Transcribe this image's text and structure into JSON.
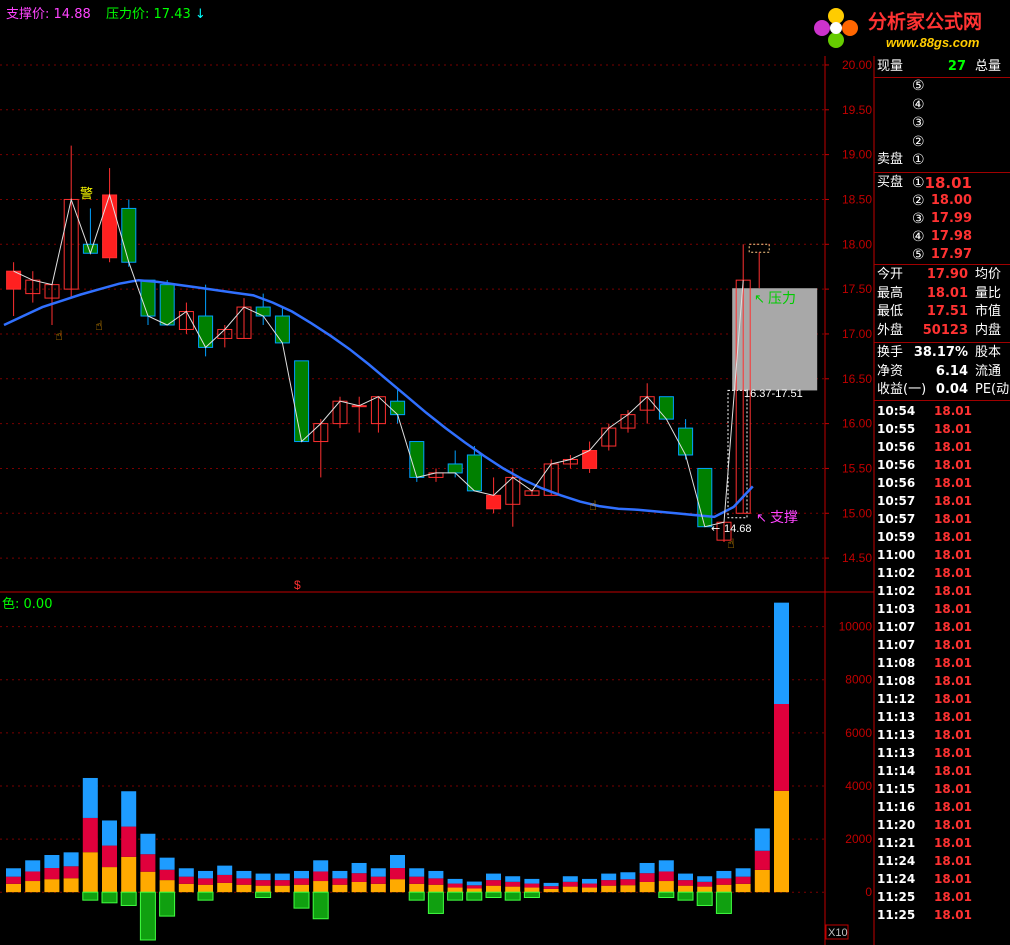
{
  "header": {
    "support_label": "支撑价:",
    "support_value": "14.88",
    "pressure_label": "压力价:",
    "pressure_value": "17.43",
    "pressure_arrow": "↓"
  },
  "volume_header": {
    "label": "色:",
    "value": "0.00"
  },
  "logo": {
    "text": "分析家公式网",
    "url": "www.88gs.com"
  },
  "annotations": {
    "warning": "警",
    "pressure": "压力",
    "support": "支撑",
    "range": "16.37-17.51",
    "low_marker": "14.68",
    "dollar": "$",
    "x10": "X10"
  },
  "quote_panel": {
    "top": {
      "label": "现量",
      "value": "27",
      "label2": "总量"
    },
    "sell_label": "卖盘",
    "buy_label": "买盘",
    "sell_levels": [
      "⑤",
      "④",
      "③",
      "②",
      "①"
    ],
    "buy_levels": [
      {
        "level": "①",
        "price": "18.01"
      },
      {
        "level": "②",
        "price": "18.00"
      },
      {
        "level": "③",
        "price": "17.99"
      },
      {
        "level": "④",
        "price": "17.98"
      },
      {
        "level": "⑤",
        "price": "17.97"
      }
    ],
    "stats": [
      {
        "label": "今开",
        "value": "17.90",
        "label2": "均价"
      },
      {
        "label": "最高",
        "value": "18.01",
        "label2": "量比"
      },
      {
        "label": "最低",
        "value": "17.51",
        "label2": "市值"
      },
      {
        "label": "外盘",
        "value": "50123",
        "label2": "内盘"
      }
    ],
    "stats2": [
      {
        "label": "换手",
        "value": "38.17%",
        "label2": "股本"
      },
      {
        "label": "净资",
        "value": "6.14",
        "label2": "流通"
      },
      {
        "label": "收益(一)",
        "value": "0.04",
        "label2": "PE(动"
      }
    ]
  },
  "ticks": [
    {
      "time": "10:54",
      "price": "18.01"
    },
    {
      "time": "10:55",
      "price": "18.01"
    },
    {
      "time": "10:56",
      "price": "18.01"
    },
    {
      "time": "10:56",
      "price": "18.01"
    },
    {
      "time": "10:56",
      "price": "18.01"
    },
    {
      "time": "10:57",
      "price": "18.01"
    },
    {
      "time": "10:57",
      "price": "18.01"
    },
    {
      "time": "10:59",
      "price": "18.01"
    },
    {
      "time": "11:00",
      "price": "18.01"
    },
    {
      "time": "11:02",
      "price": "18.01"
    },
    {
      "time": "11:02",
      "price": "18.01"
    },
    {
      "time": "11:03",
      "price": "18.01"
    },
    {
      "time": "11:07",
      "price": "18.01"
    },
    {
      "time": "11:07",
      "price": "18.01"
    },
    {
      "time": "11:08",
      "price": "18.01"
    },
    {
      "time": "11:08",
      "price": "18.01"
    },
    {
      "time": "11:12",
      "price": "18.01"
    },
    {
      "time": "11:13",
      "price": "18.01"
    },
    {
      "time": "11:13",
      "price": "18.01"
    },
    {
      "time": "11:13",
      "price": "18.01"
    },
    {
      "time": "11:14",
      "price": "18.01"
    },
    {
      "time": "11:15",
      "price": "18.01"
    },
    {
      "time": "11:16",
      "price": "18.01"
    },
    {
      "time": "11:20",
      "price": "18.01"
    },
    {
      "time": "11:21",
      "price": "18.01"
    },
    {
      "time": "11:24",
      "price": "18.01"
    },
    {
      "time": "11:24",
      "price": "18.01"
    },
    {
      "time": "11:25",
      "price": "18.01"
    },
    {
      "time": "11:25",
      "price": "18.01"
    }
  ],
  "chart_data": [
    {
      "type": "candlestick",
      "price_ticks": [
        "20.00",
        "19.50",
        "19.00",
        "18.50",
        "18.00",
        "17.50",
        "17.00",
        "16.50",
        "16.00",
        "15.50",
        "15.00",
        "14.50"
      ],
      "ylim": [
        14.2,
        20.1
      ],
      "candles": [
        {
          "o": 17.5,
          "h": 17.8,
          "l": 17.2,
          "c": 17.7
        },
        {
          "o": 17.45,
          "h": 17.7,
          "l": 17.35,
          "c": 17.6
        },
        {
          "o": 17.4,
          "h": 17.55,
          "l": 17.1,
          "c": 17.55
        },
        {
          "o": 17.5,
          "h": 19.1,
          "l": 17.4,
          "c": 18.5
        },
        {
          "o": 18.0,
          "h": 18.4,
          "l": 17.9,
          "c": 17.9
        },
        {
          "o": 17.85,
          "h": 18.85,
          "l": 17.8,
          "c": 18.55
        },
        {
          "o": 18.4,
          "h": 18.5,
          "l": 17.75,
          "c": 17.8
        },
        {
          "o": 17.6,
          "h": 17.6,
          "l": 17.1,
          "c": 17.2
        },
        {
          "o": 17.55,
          "h": 17.6,
          "l": 17.1,
          "c": 17.1
        },
        {
          "o": 17.05,
          "h": 17.35,
          "l": 17.0,
          "c": 17.25
        },
        {
          "o": 17.2,
          "h": 17.55,
          "l": 16.75,
          "c": 16.85
        },
        {
          "o": 16.95,
          "h": 17.1,
          "l": 16.85,
          "c": 17.05
        },
        {
          "o": 16.95,
          "h": 17.4,
          "l": 16.95,
          "c": 17.3
        },
        {
          "o": 17.3,
          "h": 17.45,
          "l": 17.1,
          "c": 17.2
        },
        {
          "o": 17.2,
          "h": 17.3,
          "l": 16.9,
          "c": 16.9
        },
        {
          "o": 16.7,
          "h": 16.7,
          "l": 15.8,
          "c": 15.8
        },
        {
          "o": 15.8,
          "h": 16.05,
          "l": 15.4,
          "c": 16.0
        },
        {
          "o": 16.0,
          "h": 16.3,
          "l": 15.95,
          "c": 16.25
        },
        {
          "o": 16.2,
          "h": 16.3,
          "l": 15.9,
          "c": 16.2
        },
        {
          "o": 16.0,
          "h": 16.3,
          "l": 15.9,
          "c": 16.3
        },
        {
          "o": 16.25,
          "h": 16.4,
          "l": 16.0,
          "c": 16.1
        },
        {
          "o": 15.8,
          "h": 15.8,
          "l": 15.35,
          "c": 15.4
        },
        {
          "o": 15.4,
          "h": 15.5,
          "l": 15.35,
          "c": 15.45
        },
        {
          "o": 15.55,
          "h": 15.7,
          "l": 15.4,
          "c": 15.45
        },
        {
          "o": 15.65,
          "h": 15.75,
          "l": 15.25,
          "c": 15.25
        },
        {
          "o": 15.05,
          "h": 15.4,
          "l": 15.0,
          "c": 15.2
        },
        {
          "o": 15.1,
          "h": 15.5,
          "l": 14.85,
          "c": 15.4
        },
        {
          "o": 15.2,
          "h": 15.25,
          "l": 15.2,
          "c": 15.25
        },
        {
          "o": 15.2,
          "h": 15.6,
          "l": 15.2,
          "c": 15.55
        },
        {
          "o": 15.55,
          "h": 15.65,
          "l": 15.5,
          "c": 15.6
        },
        {
          "o": 15.5,
          "h": 15.8,
          "l": 15.45,
          "c": 15.7
        },
        {
          "o": 15.75,
          "h": 16.0,
          "l": 15.7,
          "c": 15.95
        },
        {
          "o": 15.95,
          "h": 16.15,
          "l": 15.9,
          "c": 16.1
        },
        {
          "o": 16.15,
          "h": 16.45,
          "l": 16.0,
          "c": 16.3
        },
        {
          "o": 16.3,
          "h": 16.3,
          "l": 16.05,
          "c": 16.05
        },
        {
          "o": 15.95,
          "h": 16.05,
          "l": 15.6,
          "c": 15.65
        },
        {
          "o": 15.5,
          "h": 15.5,
          "l": 14.85,
          "c": 14.85
        },
        {
          "o": 14.7,
          "h": 14.9,
          "l": 14.68,
          "c": 14.9
        },
        {
          "o": 15.0,
          "h": 18.0,
          "l": 15.0,
          "c": 17.6
        }
      ],
      "ma_line": [
        17.1,
        17.2,
        17.3,
        17.37,
        17.44,
        17.5,
        17.56,
        17.6,
        17.58,
        17.55,
        17.52,
        17.49,
        17.46,
        17.43,
        17.35,
        17.25,
        17.12,
        16.98,
        16.83,
        16.66,
        16.48,
        16.3,
        16.12,
        15.95,
        15.79,
        15.64,
        15.5,
        15.38,
        15.28,
        15.2,
        15.13,
        15.08,
        15.05,
        15.04,
        15.02,
        15.0,
        14.98,
        14.96,
        15.07,
        15.3
      ],
      "pressure_zone": [
        16.37,
        17.51
      ],
      "support": 14.88,
      "pressure": 17.43
    },
    {
      "type": "bar",
      "y_ticks": [
        "10000",
        "8000",
        "6000",
        "4000",
        "2000",
        "0"
      ],
      "ylim": [
        -1800,
        11000
      ],
      "volumes": [
        900,
        1200,
        1400,
        1500,
        4300,
        2700,
        3800,
        2200,
        1300,
        900,
        800,
        1000,
        800,
        700,
        700,
        800,
        1200,
        800,
        1100,
        900,
        1400,
        900,
        800,
        500,
        400,
        700,
        600,
        500,
        350,
        600,
        500,
        700,
        750,
        1100,
        1200,
        700,
        600,
        800,
        900,
        2400,
        10900
      ],
      "negatives": [
        0,
        0,
        0,
        0,
        -300,
        -400,
        -500,
        -1800,
        -900,
        0,
        -300,
        0,
        0,
        -200,
        0,
        -600,
        -1000,
        0,
        0,
        0,
        0,
        -300,
        -800,
        -300,
        -300,
        -200,
        -300,
        -200,
        0,
        0,
        0,
        0,
        0,
        0,
        -200,
        -300,
        -500,
        -800,
        0,
        0,
        0
      ]
    }
  ]
}
